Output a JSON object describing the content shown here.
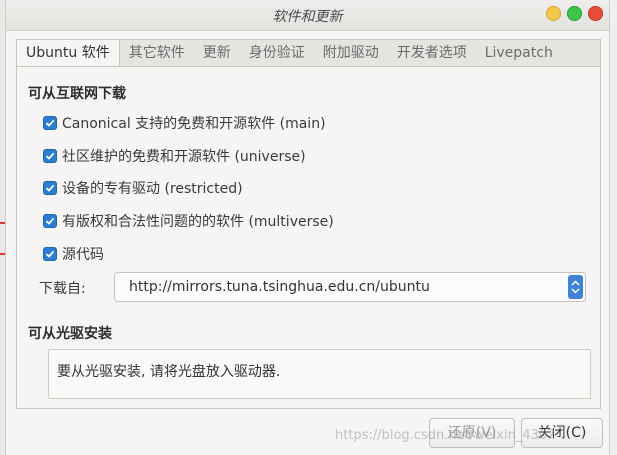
{
  "window": {
    "title": "软件和更新"
  },
  "tabs": [
    {
      "label": "Ubuntu 软件",
      "active": true
    },
    {
      "label": "其它软件"
    },
    {
      "label": "更新"
    },
    {
      "label": "身份验证"
    },
    {
      "label": "附加驱动"
    },
    {
      "label": "开发者选项"
    },
    {
      "label": "Livepatch"
    }
  ],
  "internet": {
    "heading": "可从互联网下载",
    "options": [
      {
        "label": "Canonical 支持的免费和开源软件 (main)",
        "checked": true
      },
      {
        "label": "社区维护的免费和开源软件 (universe)",
        "checked": true
      },
      {
        "label": "设备的专有驱动 (restricted)",
        "checked": true
      },
      {
        "label": "有版权和合法性问题的的软件 (multiverse)",
        "checked": true
      },
      {
        "label": "源代码",
        "checked": true
      }
    ],
    "download_from_label": "下载自:",
    "download_from_value": "http://mirrors.tuna.tsinghua.edu.cn/ubuntu"
  },
  "cdrom": {
    "heading": "可从光驱安装",
    "message": "要从光驱安装, 请将光盘放入驱动器."
  },
  "buttons": {
    "revert": "还原(V)",
    "close": "关闭(C)"
  },
  "watermark": "https://blog.csdn.net/weixin_4307",
  "colors": {
    "accent": "#2a7fd4",
    "close_dot": "#e84c3d",
    "min_dot": "#f2c94c",
    "max_dot": "#3fc44b"
  }
}
